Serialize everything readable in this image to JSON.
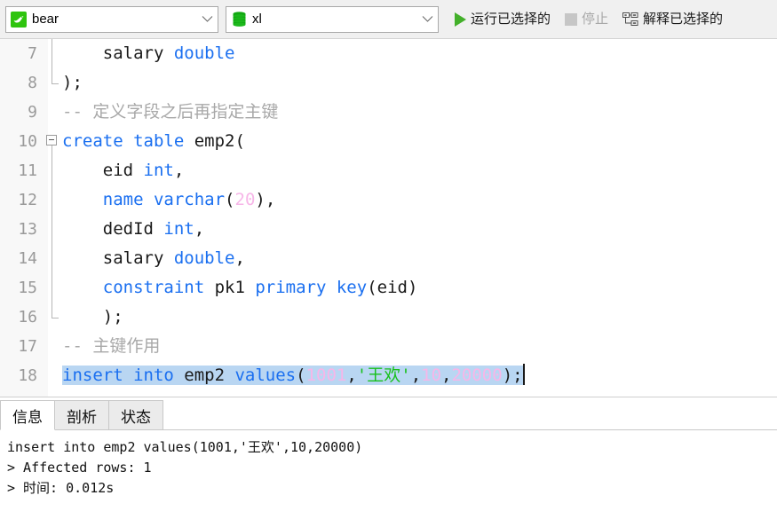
{
  "toolbar": {
    "connection": {
      "icon": "mysql-dolphin-icon",
      "value": "bear",
      "caret": "chevron-down-icon"
    },
    "database": {
      "icon": "database-cylinder-icon",
      "value": "xl",
      "caret": "chevron-down-icon"
    },
    "buttons": [
      {
        "name": "run-selected",
        "icon": "play-triangle-icon",
        "label": "运行已选择的",
        "enabled": true
      },
      {
        "name": "stop",
        "icon": "stop-square-icon",
        "label": "停止",
        "enabled": false
      },
      {
        "name": "explain-selected",
        "icon": "explain-plan-icon",
        "label": "解释已选择的",
        "enabled": true
      }
    ]
  },
  "editor": {
    "first_line_number": 7,
    "lines": [
      {
        "num": "7",
        "fold": "vline",
        "tokens": [
          {
            "t": "    ",
            "c": "pl"
          },
          {
            "t": "salary ",
            "c": "pl"
          },
          {
            "t": "double",
            "c": "kw"
          }
        ]
      },
      {
        "num": "8",
        "fold": "lend",
        "tokens": [
          {
            "t": ");",
            "c": "pl"
          }
        ]
      },
      {
        "num": "9",
        "fold": "none",
        "tokens": [
          {
            "t": "-- 定义字段之后再指定主键",
            "c": "cmt"
          }
        ]
      },
      {
        "num": "10",
        "fold": "box",
        "tokens": [
          {
            "t": "create table",
            "c": "kw"
          },
          {
            "t": " emp2(",
            "c": "pl"
          }
        ]
      },
      {
        "num": "11",
        "fold": "vline",
        "tokens": [
          {
            "t": "    eid ",
            "c": "pl"
          },
          {
            "t": "int",
            "c": "kw"
          },
          {
            "t": ",",
            "c": "pl"
          }
        ]
      },
      {
        "num": "12",
        "fold": "vline",
        "tokens": [
          {
            "t": "    ",
            "c": "pl"
          },
          {
            "t": "name varchar",
            "c": "kw"
          },
          {
            "t": "(",
            "c": "pl"
          },
          {
            "t": "20",
            "c": "num"
          },
          {
            "t": "),",
            "c": "pl"
          }
        ]
      },
      {
        "num": "13",
        "fold": "vline",
        "tokens": [
          {
            "t": "    dedId ",
            "c": "pl"
          },
          {
            "t": "int",
            "c": "kw"
          },
          {
            "t": ",",
            "c": "pl"
          }
        ]
      },
      {
        "num": "14",
        "fold": "vline",
        "tokens": [
          {
            "t": "    salary ",
            "c": "pl"
          },
          {
            "t": "double",
            "c": "kw"
          },
          {
            "t": ",",
            "c": "pl"
          }
        ]
      },
      {
        "num": "15",
        "fold": "vline",
        "tokens": [
          {
            "t": "    ",
            "c": "pl"
          },
          {
            "t": "constraint",
            "c": "kw"
          },
          {
            "t": " pk1 ",
            "c": "pl"
          },
          {
            "t": "primary key",
            "c": "kw"
          },
          {
            "t": "(eid)",
            "c": "pl"
          }
        ]
      },
      {
        "num": "16",
        "fold": "lend",
        "tokens": [
          {
            "t": "    );",
            "c": "pl"
          }
        ]
      },
      {
        "num": "17",
        "fold": "none",
        "tokens": [
          {
            "t": "-- 主键作用",
            "c": "cmt"
          }
        ]
      },
      {
        "num": "18",
        "fold": "none",
        "selected": true,
        "caret_end": true,
        "tokens": [
          {
            "t": "insert into",
            "c": "kw"
          },
          {
            "t": " emp2 ",
            "c": "pl"
          },
          {
            "t": "values",
            "c": "kw"
          },
          {
            "t": "(",
            "c": "pl"
          },
          {
            "t": "1001",
            "c": "num"
          },
          {
            "t": ",",
            "c": "pl"
          },
          {
            "t": "'王欢'",
            "c": "str"
          },
          {
            "t": ",",
            "c": "pl"
          },
          {
            "t": "10",
            "c": "num"
          },
          {
            "t": ",",
            "c": "pl"
          },
          {
            "t": "20000",
            "c": "num"
          },
          {
            "t": ");",
            "c": "pl"
          }
        ]
      }
    ]
  },
  "results_panel": {
    "tabs": [
      {
        "name": "tab-info",
        "label": "信息",
        "active": true
      },
      {
        "name": "tab-profile",
        "label": "剖析",
        "active": false
      },
      {
        "name": "tab-status",
        "label": "状态",
        "active": false
      }
    ],
    "output_lines": [
      "insert into emp2 values(1001,'王欢',10,20000)",
      "> Affected rows: 1",
      "> 时间: 0.012s"
    ]
  },
  "colors": {
    "keyword": "#1a6ff0",
    "number": "#f7b6e8",
    "string": "#17c01b",
    "comment": "#a8a8a8",
    "selection": "#b9d6f2",
    "accent_green": "#2ec40e",
    "toolbar_bg": "#f0f0f0",
    "gutter_bg": "#f8f8f8"
  }
}
